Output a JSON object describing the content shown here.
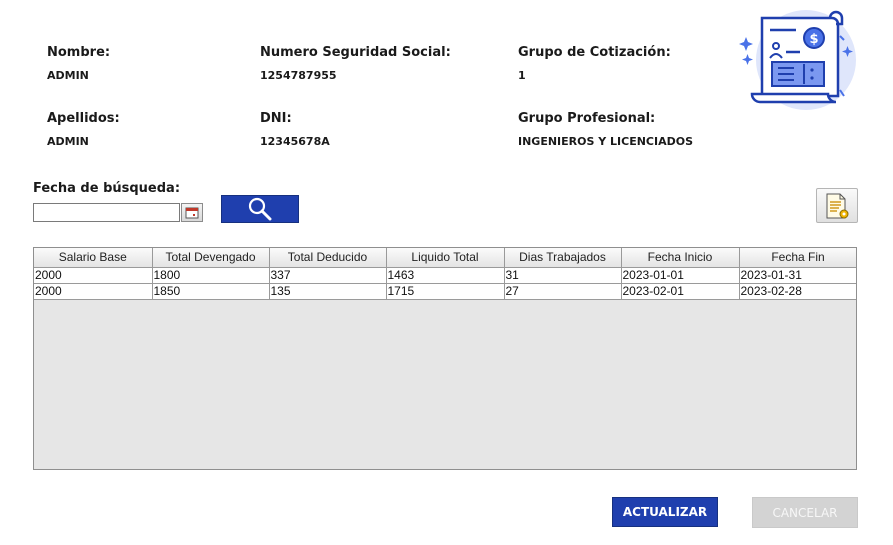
{
  "employee": {
    "nombre_label": "Nombre:",
    "nombre_value": "ADMIN",
    "nss_label": "Numero Seguridad Social:",
    "nss_value": "1254787955",
    "grupo_cot_label": "Grupo de Cotización:",
    "grupo_cot_value": "1",
    "apellidos_label": "Apellidos:",
    "apellidos_value": "ADMIN",
    "dni_label": "DNI:",
    "dni_value": "12345678A",
    "grupo_prof_label": "Grupo Profesional:",
    "grupo_prof_value": "INGENIEROS Y LICENCIADOS"
  },
  "search": {
    "label": "Fecha de búsqueda:",
    "date_value": "",
    "search_icon": "magnifier-icon",
    "calendar_icon": "calendar-icon",
    "report_icon": "document-report-icon"
  },
  "table": {
    "columns": [
      "Salario Base",
      "Total Devengado",
      "Total Deducido",
      "Liquido Total",
      "Dias Trabajados",
      "Fecha Inicio",
      "Fecha Fin"
    ],
    "rows": [
      [
        "2000",
        "1800",
        "337",
        "1463",
        "31",
        "2023-01-01",
        "2023-01-31"
      ],
      [
        "2000",
        "1850",
        "135",
        "1715",
        "27",
        "2023-02-01",
        "2023-02-28"
      ]
    ]
  },
  "buttons": {
    "actualizar": "ACTUALIZAR",
    "cancelar": "CANCELAR"
  },
  "illustration": "payroll-document-icon",
  "colors": {
    "primary_blue": "#1f3fae",
    "disabled_gray": "#d3d3d3",
    "table_background": "#e6e6e6"
  }
}
